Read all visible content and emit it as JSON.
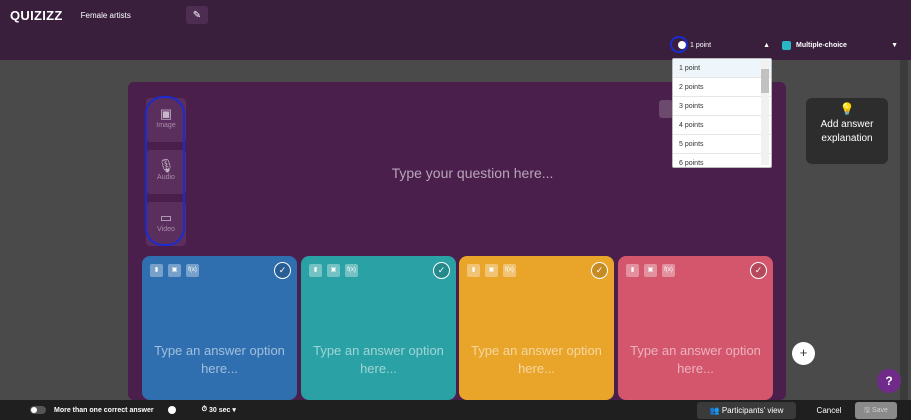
{
  "header": {
    "logo": "QUIZIZZ",
    "quiz_title": "Female artists",
    "edit_icon": "pencil-icon"
  },
  "toolbar": {
    "points_selected": "1 point",
    "question_type": "Multiple-choice"
  },
  "points_dropdown": {
    "options": [
      "1 point",
      "2 points",
      "3 points",
      "4 points",
      "5 points",
      "6 points"
    ]
  },
  "media": {
    "image_label": "Image",
    "audio_label": "Audio",
    "video_label": "Video"
  },
  "question": {
    "placeholder": "Type your question here..."
  },
  "explanation": {
    "label": "Add answer explanation"
  },
  "answers": [
    {
      "placeholder": "Type an answer option here...",
      "color": "#2f6fb0"
    },
    {
      "placeholder": "Type an answer option here...",
      "color": "#2aa1a4"
    },
    {
      "placeholder": "Type an answer option here...",
      "color": "#e9a52a"
    },
    {
      "placeholder": "Type an answer option here...",
      "color": "#d4566c"
    }
  ],
  "card_tools": {
    "bold": "B",
    "image": "▣",
    "formula": "f(x)"
  },
  "footer": {
    "multi_correct_label": "More than one correct answer",
    "timer": "30 sec",
    "participants_view": "Participants' view",
    "cancel": "Cancel",
    "save": "Save"
  },
  "help_label": "?"
}
